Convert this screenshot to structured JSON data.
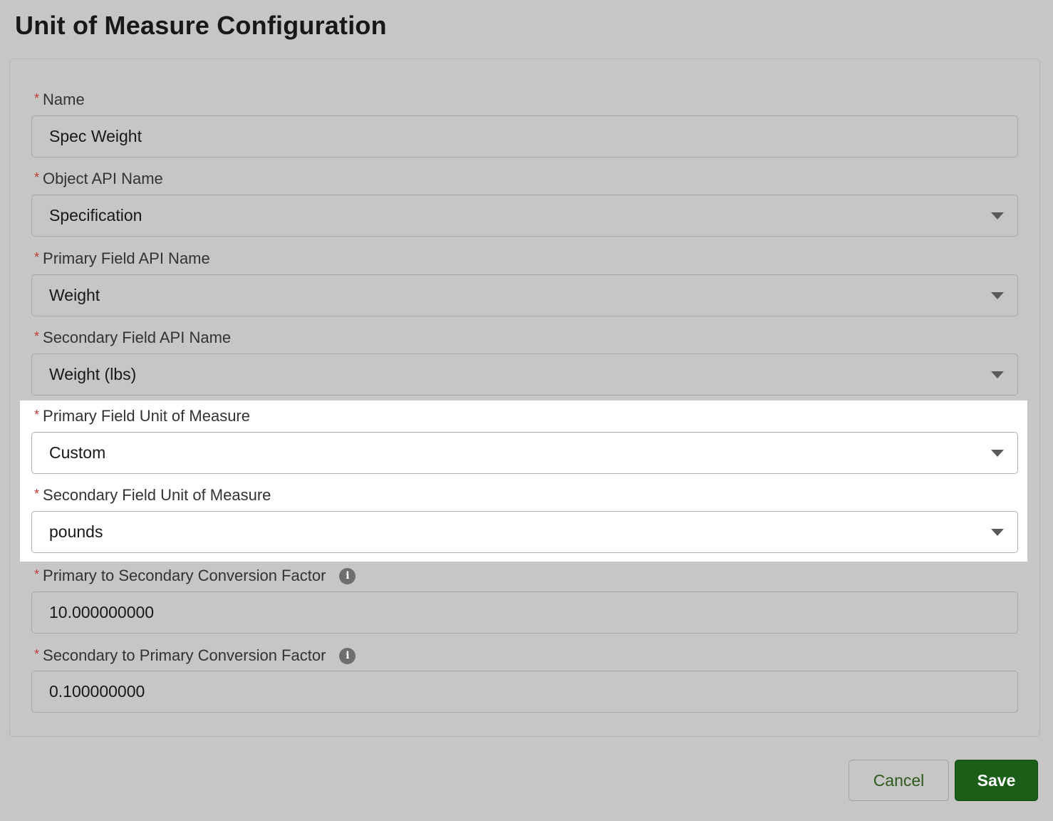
{
  "page": {
    "title": "Unit of Measure Configuration"
  },
  "form": {
    "required_marker": "*",
    "fields": [
      {
        "label": "Name",
        "value": "Spec Weight"
      },
      {
        "label": "Object API Name",
        "value": "Specification"
      },
      {
        "label": "Primary Field API Name",
        "value": "Weight"
      },
      {
        "label": "Secondary Field API Name",
        "value": "Weight (lbs)"
      },
      {
        "label": "Primary Field Unit of Measure",
        "value": "Custom"
      },
      {
        "label": "Secondary Field Unit of Measure",
        "value": "pounds"
      },
      {
        "label": "Primary to Secondary Conversion Factor",
        "value": "10.000000000"
      },
      {
        "label": "Secondary to Primary Conversion Factor",
        "value": "0.100000000"
      }
    ]
  },
  "actions": {
    "cancel_label": "Cancel",
    "save_label": "Save"
  },
  "icons": {
    "info": "info-icon",
    "dropdown": "chevron-down-icon"
  },
  "colors": {
    "background": "#c6c6c6",
    "required": "#c23934",
    "save_button": "#1b5e18",
    "cancel_text": "#2e5a1c",
    "highlight": "#ffffff"
  }
}
